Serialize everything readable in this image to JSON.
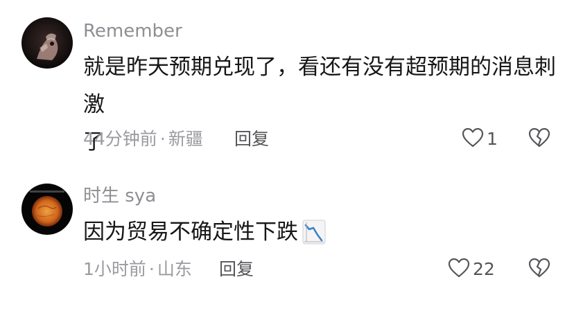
{
  "comments": [
    {
      "username": "Remember",
      "content_line1": "就是昨天预期兑现了，看还有没有超预期的消息刺激",
      "content_line2": "了",
      "time": "44分钟前",
      "separator": "·",
      "location": "新疆",
      "reply_label": "回复",
      "like_count": "1"
    },
    {
      "username": "时生 sya",
      "content": "因为贸易不确定性下跌",
      "time": "1小时前",
      "separator": "·",
      "location": "山东",
      "reply_label": "回复",
      "like_count": "22"
    }
  ],
  "icons": {
    "like": "heart-outline-icon",
    "dislike": "broken-heart-icon",
    "emoji": "chart-decreasing-emoji"
  },
  "colors": {
    "username": "#8e8e93",
    "content": "#161616",
    "meta": "#9a9a9f",
    "action": "#555559",
    "emoji_line": "#3b82c4"
  }
}
